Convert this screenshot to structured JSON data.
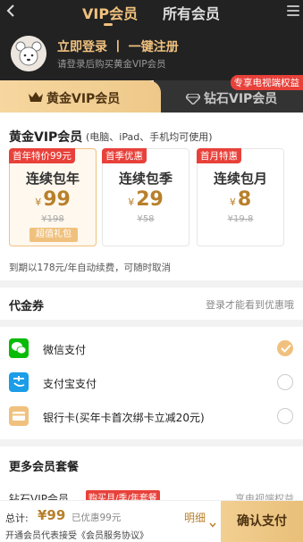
{
  "header": {
    "tabs": [
      {
        "label": "VIP会员"
      },
      {
        "label": "所有会员"
      }
    ],
    "login_title": "立即登录 丨 一键注册",
    "login_subtitle": "请登录后购买黄金VIP会员"
  },
  "membership_types": {
    "gold": "黄金VIP会员",
    "diamond": "钻石VIP会员",
    "promo": "专享电视端权益"
  },
  "packages": {
    "title": "黄金VIP会员",
    "subtitle": "(电脑、iPad、手机均可使用)",
    "currency": "¥",
    "cards": [
      {
        "badge": "首年特价99元",
        "name": "连续包年",
        "price": "99",
        "original": "¥198",
        "gift": "超值礼包"
      },
      {
        "badge": "首季优惠",
        "name": "连续包季",
        "price": "29",
        "original": "¥58"
      },
      {
        "badge": "首月特惠",
        "name": "连续包月",
        "price": "8",
        "original": "¥19.8"
      }
    ],
    "renew_note": "到期以178元/年自动续费，可随时取消"
  },
  "coupon": {
    "label": "代金券",
    "hint": "登录才能看到优惠哦"
  },
  "payment": {
    "options": [
      {
        "label": "微信支付",
        "icon": "wechat-icon",
        "color": "#09bb07"
      },
      {
        "label": "支付宝支付",
        "icon": "alipay-icon",
        "color": "#1b9de8"
      },
      {
        "label": "银行卡(买年卡首次绑卡立减20元)",
        "icon": "bank-card-icon",
        "color": "#f0c17e"
      }
    ],
    "selected_index": 0
  },
  "more_packages": {
    "title": "更多会员套餐",
    "row_label": "钻石VIP会员",
    "hot_tag": "购买月/季/年套餐",
    "right_hint": "享电视端权益"
  },
  "bottom_bar": {
    "total_label": "总计:",
    "total_value": "¥99",
    "saved": "已优惠99元",
    "agreement": "开通会员代表接受《会员服务协议》",
    "detail": "明细",
    "confirm": "确认支付"
  },
  "colors": {
    "gold_accent": "#f0c17e",
    "price_color": "#b8802b",
    "red_badge": "#e8413a",
    "header_bg": "#222222"
  }
}
